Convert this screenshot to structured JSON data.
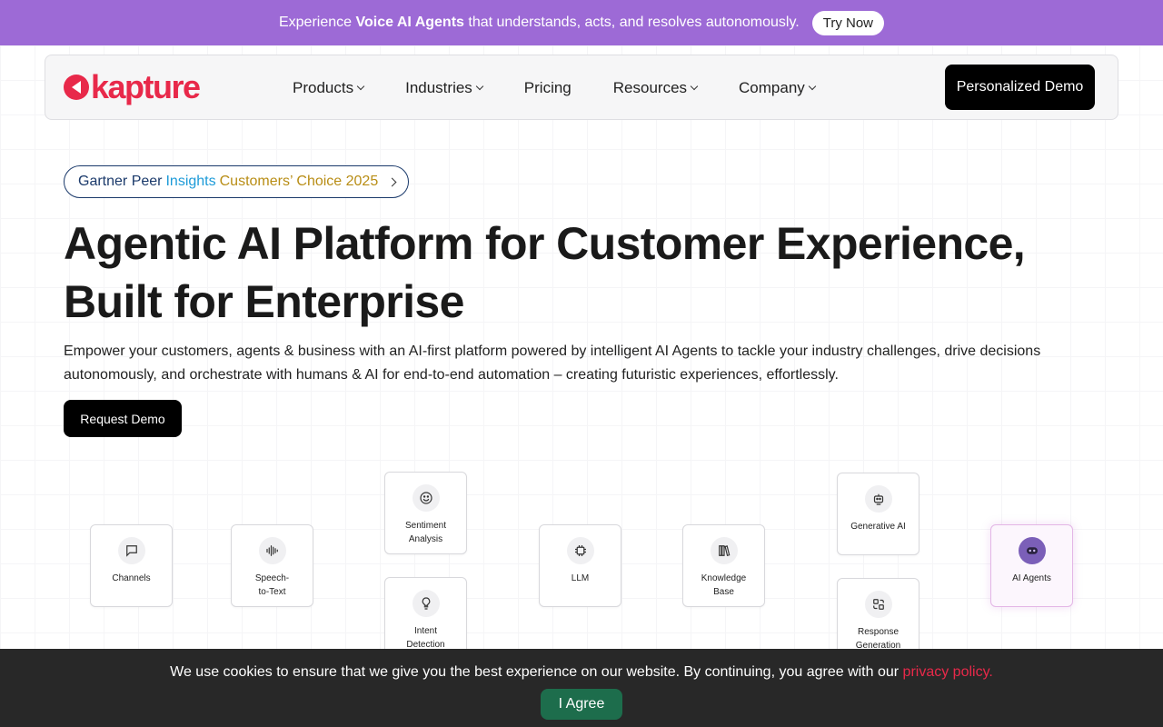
{
  "banner": {
    "prefix": "Experience",
    "bold": "Voice AI Agents",
    "suffix": "that understands, acts, and resolves autonomously.",
    "button": "Try Now",
    "color": "#9d6ad6"
  },
  "nav": {
    "logo": "kapture",
    "items": [
      "Products",
      "Industries",
      "Pricing",
      "Resources",
      "Company"
    ],
    "demo_button": "Personalized Demo"
  },
  "hero": {
    "badge": {
      "part1": "Gartner Peer",
      "part2": "Insights",
      "part3": "Customers’ Choice 2025"
    },
    "headline": "Agentic AI Platform for Customer Experience, Built for Enterprise",
    "subtext": "Empower your customers, agents & business with an AI-first platform powered by intelligent AI Agents to tackle your industry challenges, drive decisions autonomously, and orchestrate with humans & AI for end-to-end automation – creating futuristic experiences, effortlessly.",
    "cta": "Request Demo"
  },
  "flow": {
    "channels": "Channels",
    "speech": "Speech-\nto-Text",
    "sentiment": "Sentiment\nAnalysis",
    "intent": "Intent\nDetection",
    "llm": "LLM",
    "knowledge": "Knowledge\nBase",
    "generative": "Generative AI",
    "response": "Response\nGeneration",
    "agents": "AI Agents"
  },
  "cookie": {
    "message": "We use cookies to ensure that we give you the best experience on our website. By continuing, you agree with our",
    "link": "privacy policy.",
    "button": "I Agree",
    "link_color": "#e8294a"
  }
}
